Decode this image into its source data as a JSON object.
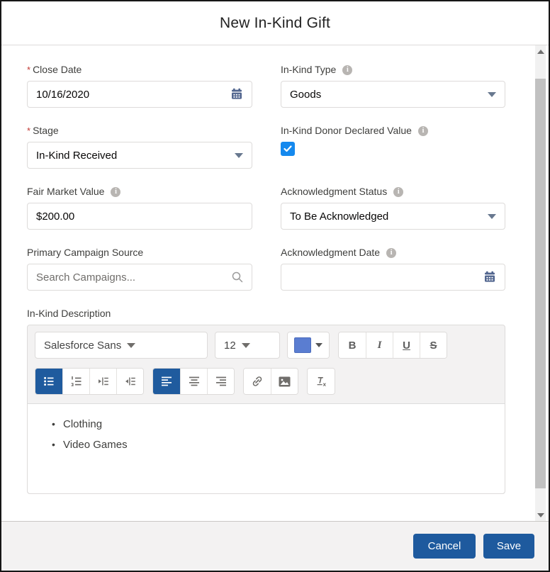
{
  "modal": {
    "title": "New In-Kind Gift"
  },
  "fields": {
    "close_date": {
      "label": "Close Date",
      "required_marker": "*",
      "value": "10/16/2020"
    },
    "in_kind_type": {
      "label": "In-Kind Type",
      "value": "Goods"
    },
    "stage": {
      "label": "Stage",
      "required_marker": "*",
      "value": "In-Kind Received"
    },
    "donor_declared_value": {
      "label": "In-Kind Donor Declared Value",
      "checked": true
    },
    "fair_market_value": {
      "label": "Fair Market Value",
      "value": "$200.00"
    },
    "acknowledgment_status": {
      "label": "Acknowledgment Status",
      "value": "To Be Acknowledged"
    },
    "primary_campaign_source": {
      "label": "Primary Campaign Source",
      "placeholder": "Search Campaigns..."
    },
    "acknowledgment_date": {
      "label": "Acknowledgment Date",
      "value": ""
    },
    "description": {
      "label": "In-Kind Description",
      "items": [
        "Clothing",
        "Video Games"
      ]
    }
  },
  "editor": {
    "font_family_value": "Salesforce Sans",
    "font_size_value": "12",
    "bold_label": "B",
    "italic_label": "I",
    "underline_label": "U",
    "strikethrough_label": "S",
    "active_buttons": [
      "bullet-list",
      "align-left"
    ],
    "text_color_swatch": "#5a7dd1"
  },
  "info_icon_glyph": "i",
  "footer": {
    "cancel_label": "Cancel",
    "save_label": "Save"
  },
  "colors": {
    "primary_button": "#1e5a9e",
    "active_toolbar_button": "#1f5b9e",
    "checkbox_checked": "#1589ee",
    "required_asterisk": "#c23934",
    "calendar_icon": "#52668f"
  }
}
